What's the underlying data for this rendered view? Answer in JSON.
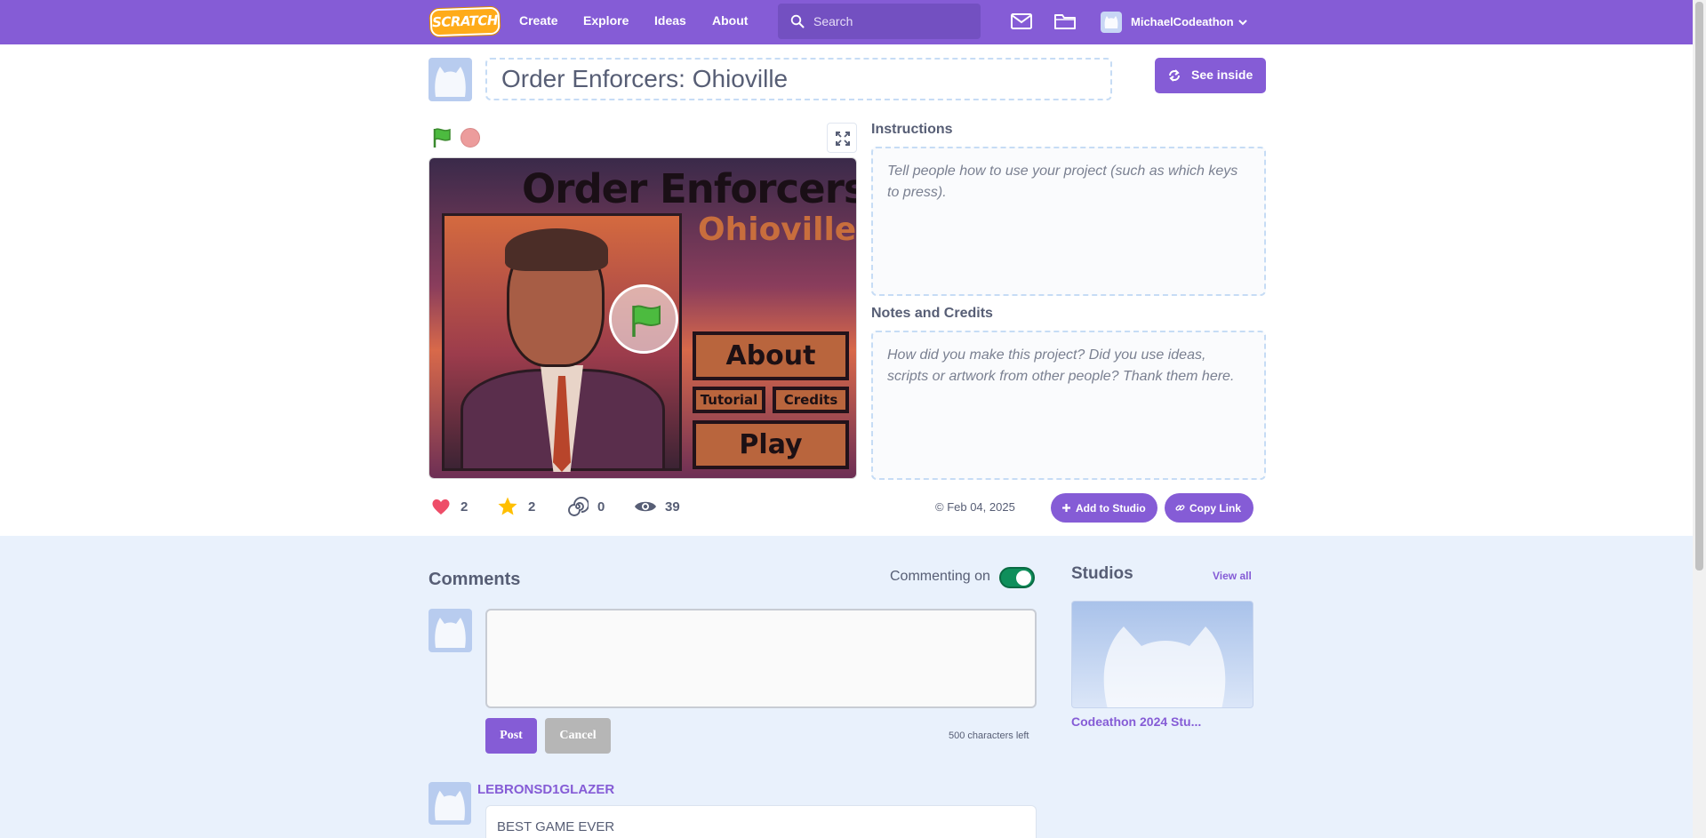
{
  "nav": {
    "logo_text": "SCRATCH",
    "links": [
      "Create",
      "Explore",
      "Ideas",
      "About"
    ],
    "search_placeholder": "Search",
    "username": "MichaelCodeathon",
    "brand_color": "#855cd6",
    "icons": [
      "search-icon",
      "messages-icon",
      "my-stuff-folder-icon",
      "chevron-down-icon"
    ]
  },
  "project": {
    "title": "Order Enforcers: Ohioville",
    "see_inside_label": "See inside",
    "instructions_label": "Instructions",
    "instructions_placeholder": "Tell people how to use your project (such as which keys to press).",
    "notes_label": "Notes and Credits",
    "notes_placeholder": "How did you make this project? Did you use ideas, scripts or artwork from other people? Thank them here.",
    "stage": {
      "title_line1": "Order Enforcers:",
      "title_line2": "Ohioville",
      "buttons": [
        "About",
        "Tutorial",
        "Credits",
        "Play"
      ]
    },
    "stats": {
      "loves": "2",
      "favorites": "2",
      "remixes": "0",
      "views": "39"
    },
    "date": "© Feb 04, 2025",
    "add_to_studio_label": "Add to Studio",
    "copy_link_label": "Copy Link"
  },
  "comments": {
    "title": "Comments",
    "commenting_status": "Commenting on",
    "commenting_enabled": true,
    "post_label": "Post",
    "cancel_label": "Cancel",
    "chars_left": "500 characters left",
    "items": [
      {
        "author": "LEBRONSD1GLAZER",
        "text": "BEST GAME EVER"
      }
    ]
  },
  "studios": {
    "title": "Studios",
    "view_all_label": "View all",
    "items": [
      {
        "name": "Codeathon 2024 Stu..."
      }
    ]
  }
}
